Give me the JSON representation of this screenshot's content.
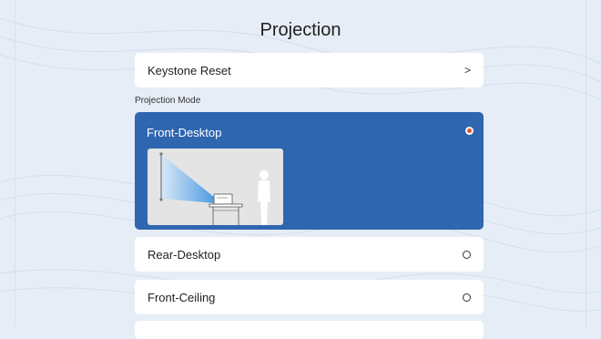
{
  "page": {
    "title": "Projection"
  },
  "keystone_reset": {
    "label": "Keystone Reset",
    "chevron": ">"
  },
  "projection_mode": {
    "section_label": "Projection Mode",
    "options": [
      {
        "label": "Front-Desktop",
        "selected": true
      },
      {
        "label": "Rear-Desktop",
        "selected": false
      },
      {
        "label": "Front-Ceiling",
        "selected": false
      }
    ]
  },
  "colors": {
    "background": "#e6edf7",
    "selected_card": "#2f66b0",
    "selected_radio_dot": "#e2572c",
    "card": "#ffffff"
  }
}
